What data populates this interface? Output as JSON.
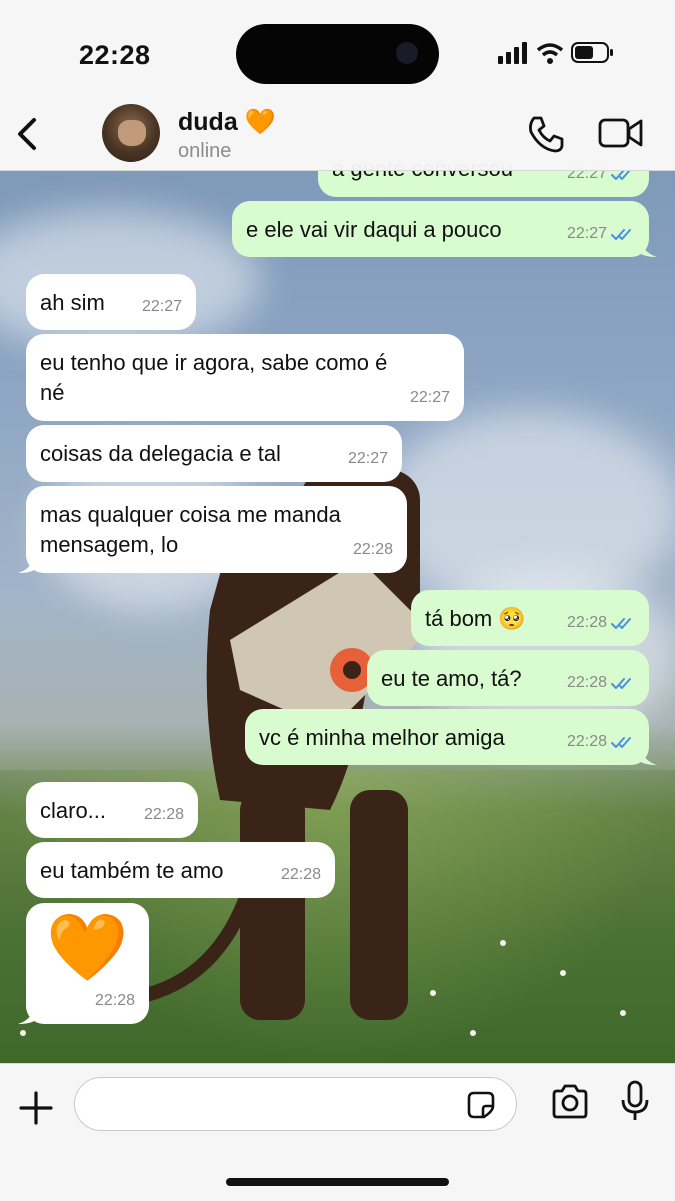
{
  "status_bar": {
    "time": "22:28"
  },
  "header": {
    "contact_name": "duda 🧡",
    "contact_status": "online"
  },
  "messages": [
    {
      "dir": "out",
      "text": "a gente conversou",
      "time": "22:27",
      "read": true
    },
    {
      "dir": "out",
      "text": "e ele vai vir daqui a pouco",
      "time": "22:27",
      "read": true
    },
    {
      "dir": "in",
      "text": "ah sim",
      "time": "22:27"
    },
    {
      "dir": "in",
      "text": "eu tenho que ir agora, sabe como é\nné",
      "time": "22:27"
    },
    {
      "dir": "in",
      "text": "coisas da delegacia e tal",
      "time": "22:27"
    },
    {
      "dir": "in",
      "text": "mas qualquer coisa me manda\nmensagem, lo",
      "time": "22:28"
    },
    {
      "dir": "out",
      "text": "tá bom 🥺",
      "time": "22:28",
      "read": true
    },
    {
      "dir": "out",
      "text": "eu te amo, tá?",
      "time": "22:28",
      "read": true
    },
    {
      "dir": "out",
      "text": "vc é minha melhor amiga",
      "time": "22:28",
      "read": true
    },
    {
      "dir": "in",
      "text": "claro...",
      "time": "22:28"
    },
    {
      "dir": "in",
      "text": "eu também te amo",
      "time": "22:28"
    },
    {
      "dir": "in",
      "text": "🧡",
      "time": "22:28",
      "emoji_only": true
    }
  ],
  "composer": {
    "placeholder": ""
  },
  "colors": {
    "incoming": "#ffffff",
    "outgoing": "#d9fbd0",
    "read_ticks": "#4a90e2"
  }
}
